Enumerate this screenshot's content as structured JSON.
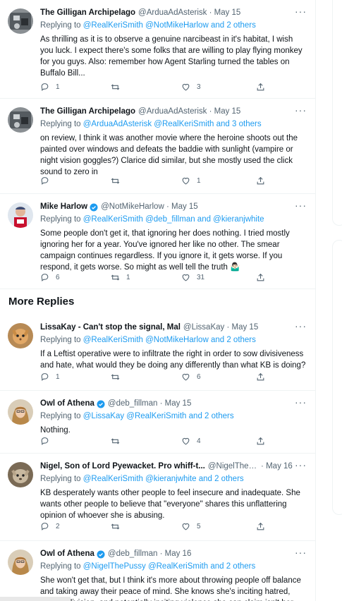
{
  "section_title": "More Replies",
  "tweets": [
    {
      "name": "The Gilligan Archipelago",
      "handle": "@ArduaAdAsterisk",
      "time": "May 15",
      "replying_prefix": "Replying to",
      "replying_to": "@RealKeriSmith @NotMikeHarlow and 2 others",
      "text": "As thrilling as it is to observe a genuine narcibeast in it's habitat, I wish you luck.  I expect there's some folks that are willing to play flying monkey for you guys.  Also: remember how Agent Starling turned the tables on Buffalo Bill...",
      "replies": "1",
      "retweets": "",
      "likes": "3"
    },
    {
      "name": "The Gilligan Archipelago",
      "handle": "@ArduaAdAsterisk",
      "time": "May 15",
      "replying_prefix": "Replying to",
      "replying_to": "@ArduaAdAsterisk @RealKeriSmith and 3 others",
      "text": "on review, I think it was another movie where the heroine shoots out the painted over windows and defeats the baddie with sunlight (vampire or night vision goggles?)  Clarice did similar, but she mostly used the click sound to zero in",
      "replies": "",
      "retweets": "",
      "likes": "1"
    },
    {
      "name": "Mike Harlow",
      "handle": "@NotMikeHarlow",
      "time": "May 15",
      "verified": true,
      "replying_prefix": "Replying to",
      "replying_to": "@RealKeriSmith @deb_fillman and @kieranjwhite",
      "text": "Some people don't get it, that ignoring her does nothing. I tried mostly ignoring her for a year. You've ignored her like no other. The smear campaign continues regardless. If you ignore it, it gets worse. If you respond, it gets worse. So might as well tell the truth 🤷🏻‍♂️",
      "replies": "6",
      "retweets": "1",
      "likes": "31"
    },
    {
      "name": "LissaKay - Can't stop the signal, Mal",
      "handle": "@LissaKay",
      "time": "May 15",
      "replying_prefix": "Replying to",
      "replying_to": "@RealKeriSmith @NotMikeHarlow and 2 others",
      "text": "If a Leftist operative were to infiltrate the right in order to sow divisiveness and hate, what would they be doing any differently than what KB is doing?",
      "replies": "1",
      "retweets": "",
      "likes": "6"
    },
    {
      "name": "Owl of Athena",
      "handle": "@deb_fillman",
      "time": "May 15",
      "verified": true,
      "replying_prefix": "Replying to",
      "replying_to": "@LissaKay @RealKeriSmith and 2 others",
      "text": "Nothing.",
      "replies": "",
      "retweets": "",
      "likes": "4"
    },
    {
      "name": "Nigel, Son of Lord Pyewacket. Pro whiff-t...",
      "handle": "@NigelThePussy",
      "handle_display": "@NigelThePussy",
      "time": "May 16",
      "replying_prefix": "Replying to",
      "replying_to": "@RealKeriSmith @kieranjwhite and 2 others",
      "text": "KB desperately wants other people to feel insecure and inadequate.  She wants other people to believe that \"everyone\" shares this unflattering opinion of whoever she is abusing.",
      "replies": "2",
      "retweets": "",
      "likes": "5"
    },
    {
      "name": "Owl of Athena",
      "handle": "@deb_fillman",
      "time": "May 16",
      "verified": true,
      "replying_prefix": "Replying to",
      "replying_to": "@NigelThePussy @RealKeriSmith and 2 others",
      "text": "She won't get that, but I think it's more about throwing people off balance and taking away their peace of mind. She knows she's inciting hatred, sowing division, and potentially inciting violence she can claim isn't her",
      "replies": "",
      "retweets": "",
      "likes": ""
    }
  ],
  "colors": {
    "link": "#1d9bf0",
    "secondary": "#536471",
    "border": "#eff3f4",
    "verified": "#1d9bf0"
  },
  "icons": [
    "reply-icon",
    "retweet-icon",
    "like-icon",
    "share-icon",
    "more-icon",
    "verified-badge-icon"
  ]
}
